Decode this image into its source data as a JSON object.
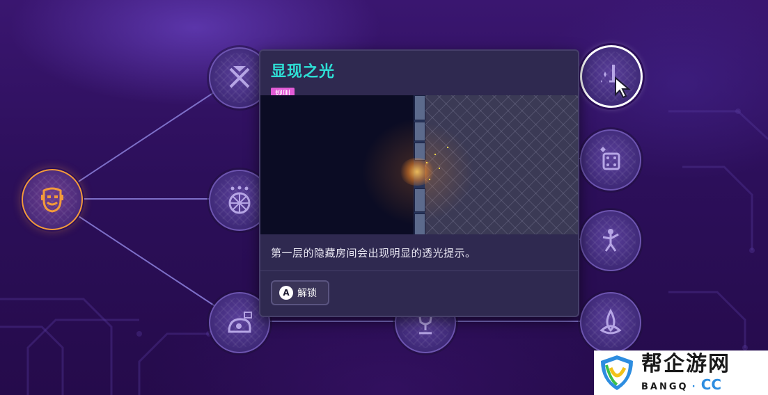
{
  "nodes": [
    {
      "id": "mask",
      "icon": "theater-mask-icon",
      "state": "active"
    },
    {
      "id": "crossed-swords",
      "icon": "crossed-swords-icon",
      "state": "locked"
    },
    {
      "id": "spinning-wheel",
      "icon": "spinning-wheel-icon",
      "state": "locked"
    },
    {
      "id": "creature",
      "icon": "creature-icon",
      "state": "locked"
    },
    {
      "id": "chest",
      "icon": "chest-icon",
      "state": "locked"
    },
    {
      "id": "chalice",
      "icon": "chalice-icon",
      "state": "locked"
    },
    {
      "id": "sparkle-sword",
      "icon": "sparkle-sword-icon",
      "state": "selected"
    },
    {
      "id": "dice",
      "icon": "dice-icon",
      "state": "locked"
    },
    {
      "id": "dancer",
      "icon": "dancer-icon",
      "state": "locked"
    },
    {
      "id": "triquetra",
      "icon": "triquetra-icon",
      "state": "locked"
    }
  ],
  "card": {
    "title": "显现之光",
    "tag": "规则",
    "description": "第一层的隐藏房间会出现明显的透光提示。",
    "button_key": "A",
    "button_label": "解锁"
  },
  "watermark": {
    "cn": "帮企游网",
    "en": "BANGQ",
    "dot": "·",
    "cc": "CC"
  },
  "colors": {
    "title": "#2ee0d6",
    "tag": "#e25bd6",
    "active_ring": "#f39a3a",
    "selected_ring": "#ffffff",
    "background": "#2c0f5a"
  }
}
